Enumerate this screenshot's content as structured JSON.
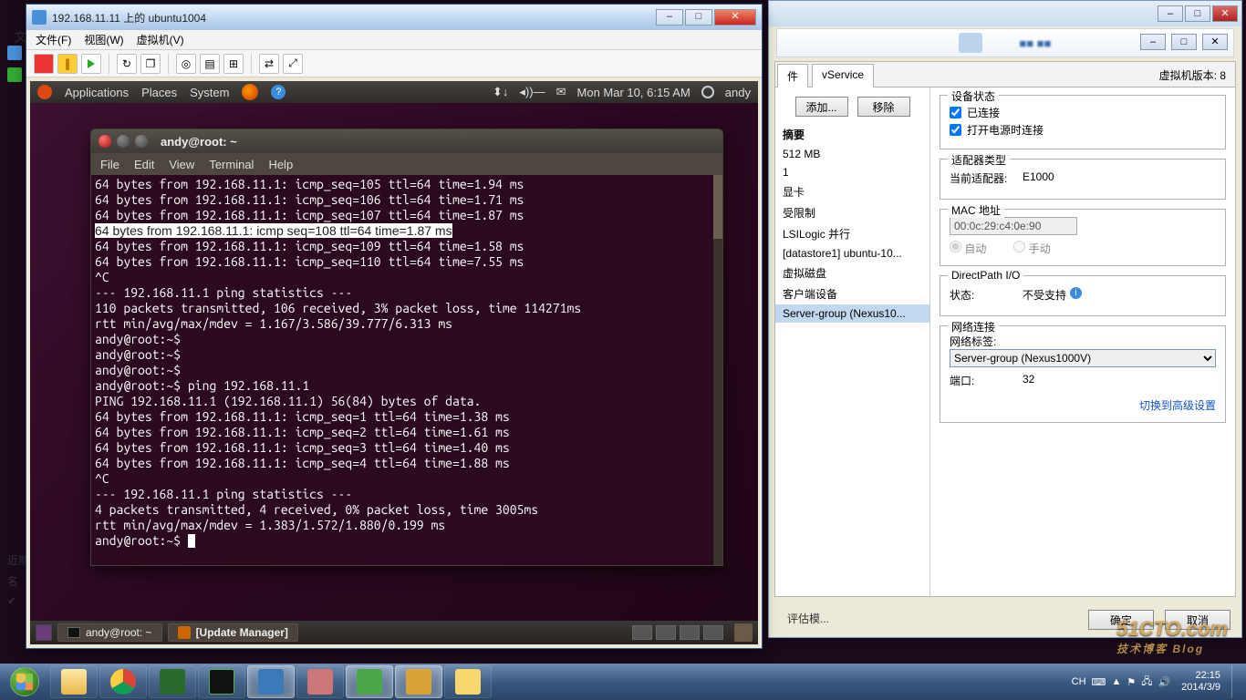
{
  "host_text": "文",
  "host_rows": {
    "recent": "近期",
    "name": "名",
    "stat": "✔"
  },
  "brand": {
    "main": "51CTO.com",
    "sub": "技术博客 Blog"
  },
  "taskbar": {
    "ime": "CH",
    "time": "22:15",
    "date": "2014/3/9"
  },
  "vsphere": {
    "titlebtns": [
      "–",
      "□",
      "✕"
    ],
    "tabs": [
      "件",
      "vService"
    ],
    "vm_version": "虚拟机版本: 8",
    "add": "添加...",
    "remove": "移除",
    "summary_head": "摘要",
    "hw": [
      {
        "k": "",
        "v": "512 MB"
      },
      {
        "k": "",
        "v": "1"
      },
      {
        "k": "显卡",
        "v": ""
      },
      {
        "k": "受限制",
        "v": ""
      },
      {
        "k": "LSILogic 并行",
        "v": ""
      },
      {
        "k": "[datastore1] ubuntu-10...",
        "v": ""
      },
      {
        "k": "虚拟磁盘",
        "v": ""
      },
      {
        "k": "客户端设备",
        "v": ""
      },
      {
        "k": "Server-group (Nexus10...",
        "v": ""
      }
    ],
    "dev_state": {
      "title": "设备状态",
      "connected": "已连接",
      "on_power": "打开电源时连接"
    },
    "adapter": {
      "title": "适配器类型",
      "label": "当前适配器:",
      "value": "E1000"
    },
    "mac": {
      "title": "MAC 地址",
      "value": "00:0c:29:c4:0e:90",
      "auto": "自动",
      "manual": "手动"
    },
    "direct": {
      "title": "DirectPath I/O",
      "label": "状态:",
      "value": "不受支持"
    },
    "net": {
      "title": "网络连接",
      "tag": "网络标签:",
      "sel": "Server-group (Nexus1000V)",
      "port_lbl": "端口:",
      "port_val": "32",
      "adv": "切换到高级设置"
    },
    "ok": "确定",
    "cancel": "取消",
    "eval": "评估模..."
  },
  "vmwin": {
    "title": "192.168.11.11 上的 ubuntu1004",
    "menu": [
      "文件(F)",
      "视图(W)",
      "虚拟机(V)"
    ],
    "ubuntu_top": {
      "apps": "Applications",
      "places": "Places",
      "system": "System",
      "net": "⬍↓",
      "snd": "◂))—",
      "date": "Mon Mar 10,  6:15 AM",
      "user": "andy"
    },
    "task1": "andy@root: ~",
    "task2": "[Update Manager]",
    "term": {
      "title": "andy@root: ~",
      "menu": [
        "File",
        "Edit",
        "View",
        "Terminal",
        "Help"
      ],
      "lines": [
        "64 bytes from 192.168.11.1: icmp_seq=105 ttl=64 time=1.94 ms",
        "64 bytes from 192.168.11.1: icmp_seq=106 ttl=64 time=1.71 ms",
        "64 bytes from 192.168.11.1: icmp_seq=107 ttl=64 time=1.87 ms",
        "64 bytes from 192.168.11.1: icmp seq=108 ttl=64 time=1.87 ms",
        "64 bytes from 192.168.11.1: icmp_seq=109 ttl=64 time=1.58 ms",
        "64 bytes from 192.168.11.1: icmp_seq=110 ttl=64 time=7.55 ms",
        "^C",
        "--- 192.168.11.1 ping statistics ---",
        "110 packets transmitted, 106 received, 3% packet loss, time 114271ms",
        "rtt min/avg/max/mdev = 1.167/3.586/39.777/6.313 ms",
        "andy@root:~$ ",
        "andy@root:~$ ",
        "andy@root:~$ ",
        "andy@root:~$ ping 192.168.11.1",
        "PING 192.168.11.1 (192.168.11.1) 56(84) bytes of data.",
        "64 bytes from 192.168.11.1: icmp_seq=1 ttl=64 time=1.38 ms",
        "64 bytes from 192.168.11.1: icmp_seq=2 ttl=64 time=1.61 ms",
        "64 bytes from 192.168.11.1: icmp_seq=3 ttl=64 time=1.40 ms",
        "64 bytes from 192.168.11.1: icmp_seq=4 ttl=64 time=1.88 ms",
        "^C",
        "--- 192.168.11.1 ping statistics ---",
        "4 packets transmitted, 4 received, 0% packet loss, time 3005ms",
        "rtt min/avg/max/mdev = 1.383/1.572/1.880/0.199 ms",
        "andy@root:~$ "
      ],
      "hl_index": 3
    }
  }
}
